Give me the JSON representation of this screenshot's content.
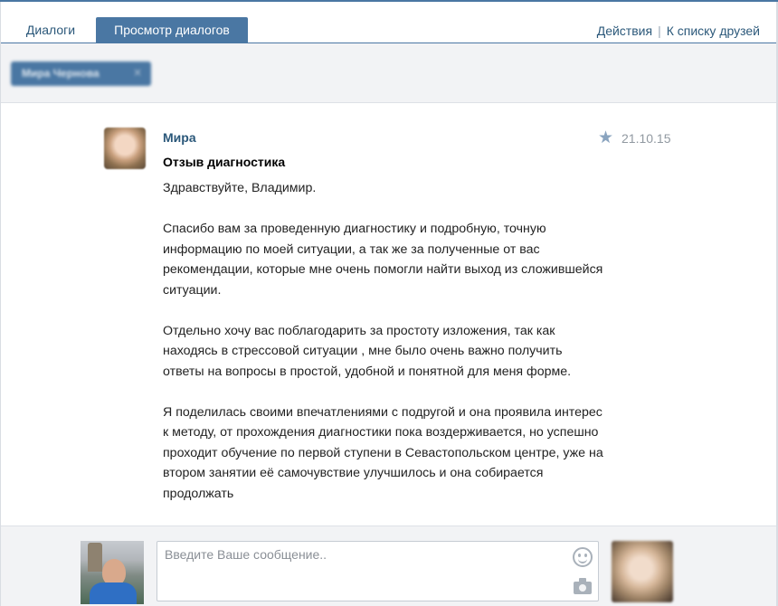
{
  "tabs": [
    {
      "label": "Диалоги"
    },
    {
      "label": "Просмотр диалогов"
    }
  ],
  "header_links": {
    "actions": "Действия",
    "separator": "|",
    "friends": "К списку друзей"
  },
  "filter": {
    "chip_label": "Мира Чернова",
    "chip_close": "×"
  },
  "message": {
    "sender": "Мира",
    "date": "21.10.15",
    "subject": "Отзыв диагностика",
    "star_icon": "star-icon",
    "paragraphs": [
      "Здравствуйте, Владимир.",
      "Спасибо вам за проведенную диагностику и подробную, точную информацию по моей ситуации, а так же за полученные от вас рекомендации, которые мне очень помогли найти выход из сложившейся ситуации.",
      "Отдельно хочу вас поблагодарить за простоту изложения, так как находясь в стрессовой ситуации , мне было очень важно получить ответы на вопросы в простой, удобной и понятной для меня форме.",
      "Я поделилась своими впечатлениями с подругой и она проявила интерес к методу, от прохождения диагностики пока воздерживается, но успешно проходит обучение по первой ступени в Севастопольском центре, уже на втором занятии её самочувствие улучшилось и она собирается продолжать"
    ]
  },
  "composer": {
    "placeholder": "Введите Ваше сообщение..",
    "value": "",
    "icons": [
      "smile-icon",
      "camera-icon"
    ]
  },
  "colors": {
    "accent": "#4a77a3",
    "link": "#2b587a",
    "panel_bg": "#f2f3f5"
  }
}
